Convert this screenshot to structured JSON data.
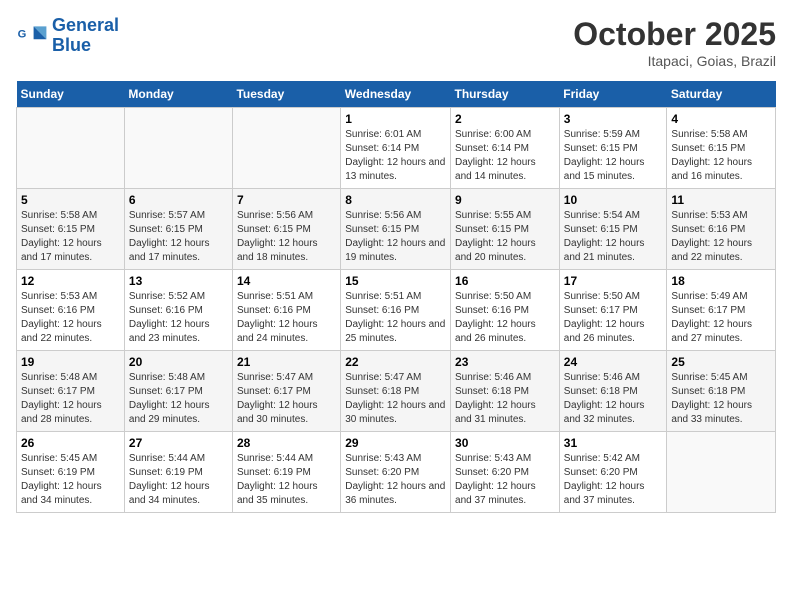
{
  "header": {
    "logo_line1": "General",
    "logo_line2": "Blue",
    "month": "October 2025",
    "location": "Itapaci, Goias, Brazil"
  },
  "weekdays": [
    "Sunday",
    "Monday",
    "Tuesday",
    "Wednesday",
    "Thursday",
    "Friday",
    "Saturday"
  ],
  "weeks": [
    [
      {
        "day": "",
        "info": ""
      },
      {
        "day": "",
        "info": ""
      },
      {
        "day": "",
        "info": ""
      },
      {
        "day": "1",
        "info": "Sunrise: 6:01 AM\nSunset: 6:14 PM\nDaylight: 12 hours\nand 13 minutes."
      },
      {
        "day": "2",
        "info": "Sunrise: 6:00 AM\nSunset: 6:14 PM\nDaylight: 12 hours\nand 14 minutes."
      },
      {
        "day": "3",
        "info": "Sunrise: 5:59 AM\nSunset: 6:15 PM\nDaylight: 12 hours\nand 15 minutes."
      },
      {
        "day": "4",
        "info": "Sunrise: 5:58 AM\nSunset: 6:15 PM\nDaylight: 12 hours\nand 16 minutes."
      }
    ],
    [
      {
        "day": "5",
        "info": "Sunrise: 5:58 AM\nSunset: 6:15 PM\nDaylight: 12 hours\nand 17 minutes."
      },
      {
        "day": "6",
        "info": "Sunrise: 5:57 AM\nSunset: 6:15 PM\nDaylight: 12 hours\nand 17 minutes."
      },
      {
        "day": "7",
        "info": "Sunrise: 5:56 AM\nSunset: 6:15 PM\nDaylight: 12 hours\nand 18 minutes."
      },
      {
        "day": "8",
        "info": "Sunrise: 5:56 AM\nSunset: 6:15 PM\nDaylight: 12 hours\nand 19 minutes."
      },
      {
        "day": "9",
        "info": "Sunrise: 5:55 AM\nSunset: 6:15 PM\nDaylight: 12 hours\nand 20 minutes."
      },
      {
        "day": "10",
        "info": "Sunrise: 5:54 AM\nSunset: 6:15 PM\nDaylight: 12 hours\nand 21 minutes."
      },
      {
        "day": "11",
        "info": "Sunrise: 5:53 AM\nSunset: 6:16 PM\nDaylight: 12 hours\nand 22 minutes."
      }
    ],
    [
      {
        "day": "12",
        "info": "Sunrise: 5:53 AM\nSunset: 6:16 PM\nDaylight: 12 hours\nand 22 minutes."
      },
      {
        "day": "13",
        "info": "Sunrise: 5:52 AM\nSunset: 6:16 PM\nDaylight: 12 hours\nand 23 minutes."
      },
      {
        "day": "14",
        "info": "Sunrise: 5:51 AM\nSunset: 6:16 PM\nDaylight: 12 hours\nand 24 minutes."
      },
      {
        "day": "15",
        "info": "Sunrise: 5:51 AM\nSunset: 6:16 PM\nDaylight: 12 hours\nand 25 minutes."
      },
      {
        "day": "16",
        "info": "Sunrise: 5:50 AM\nSunset: 6:16 PM\nDaylight: 12 hours\nand 26 minutes."
      },
      {
        "day": "17",
        "info": "Sunrise: 5:50 AM\nSunset: 6:17 PM\nDaylight: 12 hours\nand 26 minutes."
      },
      {
        "day": "18",
        "info": "Sunrise: 5:49 AM\nSunset: 6:17 PM\nDaylight: 12 hours\nand 27 minutes."
      }
    ],
    [
      {
        "day": "19",
        "info": "Sunrise: 5:48 AM\nSunset: 6:17 PM\nDaylight: 12 hours\nand 28 minutes."
      },
      {
        "day": "20",
        "info": "Sunrise: 5:48 AM\nSunset: 6:17 PM\nDaylight: 12 hours\nand 29 minutes."
      },
      {
        "day": "21",
        "info": "Sunrise: 5:47 AM\nSunset: 6:17 PM\nDaylight: 12 hours\nand 30 minutes."
      },
      {
        "day": "22",
        "info": "Sunrise: 5:47 AM\nSunset: 6:18 PM\nDaylight: 12 hours\nand 30 minutes."
      },
      {
        "day": "23",
        "info": "Sunrise: 5:46 AM\nSunset: 6:18 PM\nDaylight: 12 hours\nand 31 minutes."
      },
      {
        "day": "24",
        "info": "Sunrise: 5:46 AM\nSunset: 6:18 PM\nDaylight: 12 hours\nand 32 minutes."
      },
      {
        "day": "25",
        "info": "Sunrise: 5:45 AM\nSunset: 6:18 PM\nDaylight: 12 hours\nand 33 minutes."
      }
    ],
    [
      {
        "day": "26",
        "info": "Sunrise: 5:45 AM\nSunset: 6:19 PM\nDaylight: 12 hours\nand 34 minutes."
      },
      {
        "day": "27",
        "info": "Sunrise: 5:44 AM\nSunset: 6:19 PM\nDaylight: 12 hours\nand 34 minutes."
      },
      {
        "day": "28",
        "info": "Sunrise: 5:44 AM\nSunset: 6:19 PM\nDaylight: 12 hours\nand 35 minutes."
      },
      {
        "day": "29",
        "info": "Sunrise: 5:43 AM\nSunset: 6:20 PM\nDaylight: 12 hours\nand 36 minutes."
      },
      {
        "day": "30",
        "info": "Sunrise: 5:43 AM\nSunset: 6:20 PM\nDaylight: 12 hours\nand 37 minutes."
      },
      {
        "day": "31",
        "info": "Sunrise: 5:42 AM\nSunset: 6:20 PM\nDaylight: 12 hours\nand 37 minutes."
      },
      {
        "day": "",
        "info": ""
      }
    ]
  ]
}
